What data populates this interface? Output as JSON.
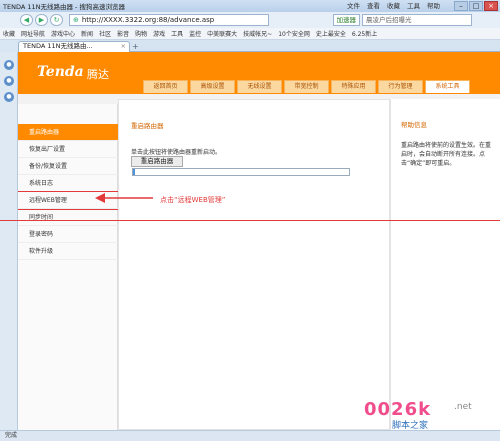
{
  "browser": {
    "title": "TENDA 11N无线路由器 - 搜狗高速浏览器",
    "menu": [
      "文件",
      "查看",
      "收藏",
      "工具",
      "帮助"
    ],
    "url": "http://XXXX.3322.org:88/advance.asp",
    "accelerate": "加速器",
    "search_placeholder": "晨凌户后招曝光",
    "bookmarks": [
      "收藏",
      "网址导航",
      "游戏中心",
      "新闻",
      "社区",
      "影音",
      "购物",
      "游戏",
      "工具",
      "监控",
      "中美联赛大",
      "技威帐兄~",
      "10个安全网",
      "史上最安全",
      "6.25新上"
    ],
    "tab_label": "TENDA 11N无线路由...",
    "status": "完成"
  },
  "router": {
    "logo": "Tenda",
    "logo_cn": "腾达",
    "nav_tabs": [
      "返回首页",
      "高级设置",
      "无线设置",
      "带宽控制",
      "特殊应用",
      "行为管理",
      "系统工具"
    ],
    "side_items": [
      "重启路由器",
      "恢复出厂设置",
      "备份/恢复设置",
      "系统日志",
      "远程WEB管理",
      "同步时间",
      "登录密码",
      "软件升级"
    ],
    "main_title": "重启路由器",
    "main_desc": "单击此按钮将使路由器重新启动。",
    "reboot_button": "重启路由器",
    "progress": 0.01,
    "help_title": "帮助信息",
    "help_text": "重启路由将使前的设置生效。在重启时，会自动断开所有连接。点击“确定”即可重启。"
  },
  "annotation": "点击“远程WEB管理”",
  "watermark": {
    "num": "0026k",
    "net": ".net",
    "cn": "脚本之家"
  },
  "colors": {
    "brand": "#ff8a00",
    "annotation": "#e23a3a"
  }
}
